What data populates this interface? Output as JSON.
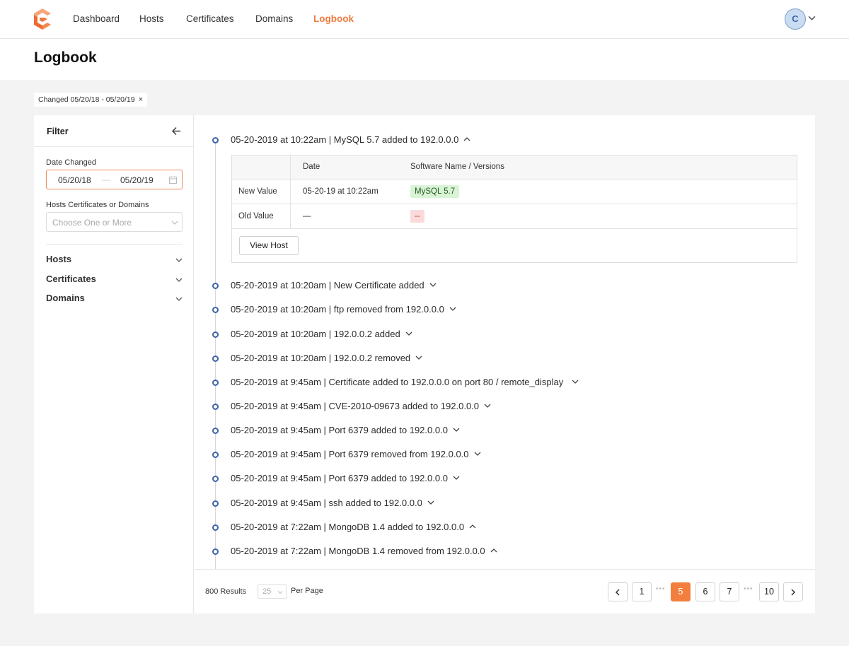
{
  "nav": {
    "items": [
      {
        "label": "Dashboard"
      },
      {
        "label": "Hosts"
      },
      {
        "label": "Certificates"
      },
      {
        "label": "Domains"
      },
      {
        "label": "Logbook",
        "active": true
      }
    ],
    "avatar_initial": "C"
  },
  "page": {
    "title": "Logbook"
  },
  "chip": {
    "label": "Changed 05/20/18 - 05/20/19",
    "close": "×"
  },
  "filter": {
    "title": "Filter",
    "date_label": "Date Changed",
    "date_from": "05/20/18",
    "date_sep": "—",
    "date_to": "05/20/19",
    "hcd_label": "Hosts Certificates or Domains",
    "hcd_placeholder": "Choose One or More",
    "sections": [
      "Hosts",
      "Certificates",
      "Domains"
    ]
  },
  "log": {
    "entries": [
      {
        "text": "05-20-2019 at 10:22am | MySQL 5.7 added to 192.0.0.0",
        "expanded": true
      },
      {
        "text": "05-20-2019 at 10:20am | New Certificate added",
        "expanded": false
      },
      {
        "text": "05-20-2019 at 10:20am | ftp removed from 192.0.0.0",
        "expanded": false
      },
      {
        "text": "05-20-2019 at 10:20am | 192.0.0.2 added",
        "expanded": false
      },
      {
        "text": "05-20-2019 at 10:20am | 192.0.0.2 removed",
        "expanded": false
      },
      {
        "text": "05-20-2019 at 9:45am | Certificate added to 192.0.0.0 on port 80 / remote_display",
        "expanded": false
      },
      {
        "text": "05-20-2019 at 9:45am | CVE-2010-09673 added to 192.0.0.0",
        "expanded": false
      },
      {
        "text": "05-20-2019 at 9:45am | Port 6379 added to 192.0.0.0",
        "expanded": false
      },
      {
        "text": "05-20-2019 at 9:45am | Port 6379 removed from 192.0.0.0",
        "expanded": false
      },
      {
        "text": "05-20-2019 at 9:45am | Port 6379 added to 192.0.0.0",
        "expanded": false
      },
      {
        "text": "05-20-2019 at 9:45am | ssh added to 192.0.0.0",
        "expanded": false
      },
      {
        "text": "05-20-2019 at 7:22am | MongoDB 1.4 added to 192.0.0.0",
        "expanded": true
      },
      {
        "text": "05-20-2019 at 7:22am | MongoDB 1.4 removed from 192.0.0.0",
        "expanded": true
      }
    ],
    "detail": {
      "headers": [
        "",
        "Date",
        "Software Name / Versions"
      ],
      "new_value": {
        "label": "New Value",
        "date": "05-20-19 at 10:22am",
        "software": "MySQL 5.7"
      },
      "old_value": {
        "label": "Old Value",
        "date": "—",
        "software": "--"
      },
      "button": "View Host"
    }
  },
  "footer": {
    "results": "800 Results",
    "per_page_value": "25",
    "per_page_label": "Per Page",
    "pages": [
      "1",
      "5",
      "6",
      "7",
      "10"
    ],
    "current_page": "5",
    "ellipsis": "•••"
  },
  "colors": {
    "accent": "#f27f3d",
    "timeline_dot": "#3d63a7",
    "avatar_bg": "#c9dcf1"
  }
}
